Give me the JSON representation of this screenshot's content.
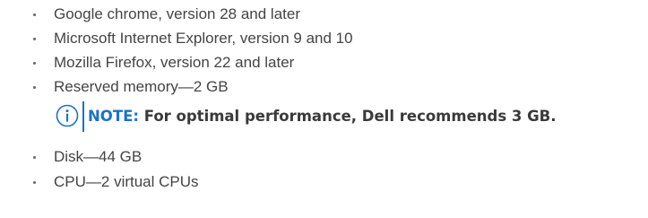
{
  "requirements": {
    "browser_items": [
      "Google chrome, version 28 and later",
      "Microsoft Internet Explorer, version 9 and 10",
      "Mozilla Firefox, version 22 and later",
      "Reserved memory—2 GB"
    ],
    "note": {
      "icon": "info-circle-icon",
      "label": "NOTE:",
      "text": " For optimal performance, Dell recommends 3 GB."
    },
    "resource_items": [
      "Disk—44 GB",
      "CPU—2 virtual CPUs"
    ]
  },
  "colors": {
    "note_accent": "#1a73c8",
    "body_text": "#444444"
  }
}
